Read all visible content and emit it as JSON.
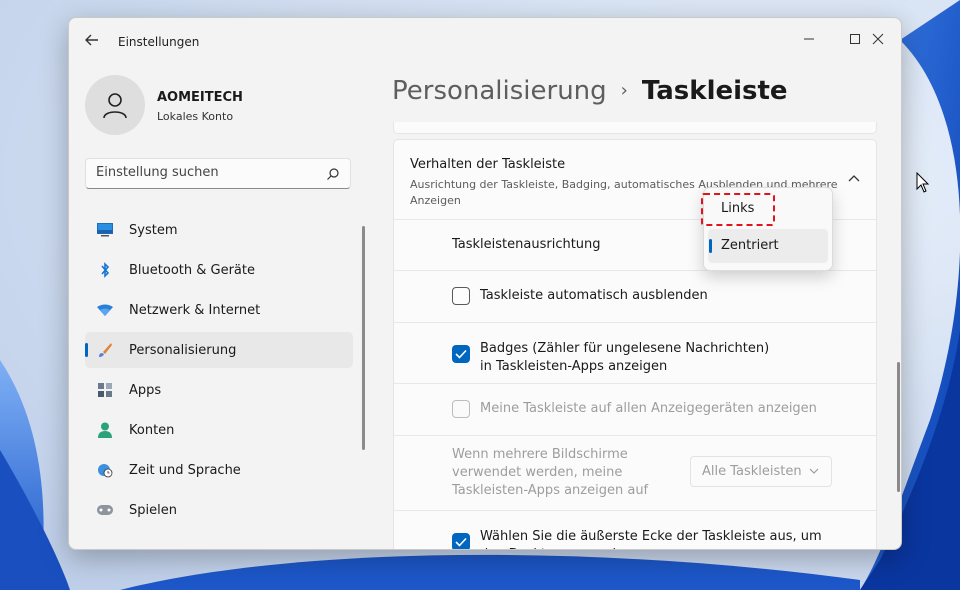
{
  "window": {
    "title": "Einstellungen"
  },
  "account": {
    "name": "AOMEITECH",
    "type": "Lokales Konto"
  },
  "search": {
    "placeholder": "Einstellung suchen"
  },
  "nav": {
    "items": [
      {
        "label": "System",
        "icon": "monitor-icon"
      },
      {
        "label": "Bluetooth & Geräte",
        "icon": "bluetooth-icon"
      },
      {
        "label": "Netzwerk & Internet",
        "icon": "wifi-icon"
      },
      {
        "label": "Personalisierung",
        "icon": "brush-icon",
        "active": true
      },
      {
        "label": "Apps",
        "icon": "apps-icon"
      },
      {
        "label": "Konten",
        "icon": "person-icon"
      },
      {
        "label": "Zeit und Sprache",
        "icon": "globe-clock-icon"
      },
      {
        "label": "Spielen",
        "icon": "gamepad-icon"
      }
    ]
  },
  "breadcrumb": {
    "parent": "Personalisierung",
    "separator": "›",
    "current": "Taskleiste"
  },
  "section": {
    "title": "Verhalten der Taskleiste",
    "description": "Ausrichtung der Taskleiste, Badging, automatisches Ausblenden und mehrere Anzeigen",
    "alignment_label": "Taskleistenausrichtung",
    "auto_hide": {
      "label": "Taskleiste automatisch ausblenden",
      "checked": false
    },
    "badges": {
      "label": "Badges (Zähler für ungelesene Nachrichten) in Taskleisten-Apps anzeigen",
      "checked": true
    },
    "all_displays": {
      "label": "Meine Taskleiste auf allen Anzeigegeräten anzeigen",
      "checked": false,
      "disabled": true
    },
    "multi_display": {
      "label": "Wenn mehrere Bildschirme verwendet werden, meine Taskleisten-Apps anzeigen auf",
      "value": "Alle Taskleisten"
    },
    "far_corner": {
      "label": "Wählen Sie die äußerste Ecke der Taskleiste aus, um den Desktop anzuzeigen",
      "checked": true
    }
  },
  "alignment_menu": {
    "options": [
      "Links",
      "Zentriert"
    ],
    "selected": "Zentriert",
    "highlighted": "Links"
  },
  "colors": {
    "accent": "#0067c0",
    "highlight": "#e0141c"
  }
}
